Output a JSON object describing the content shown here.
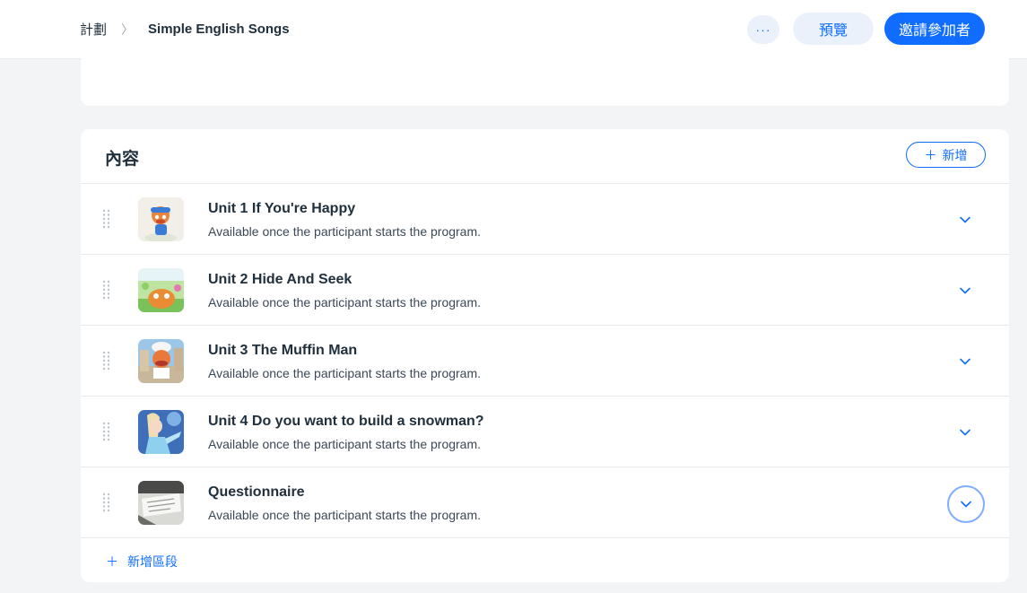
{
  "breadcrumb": {
    "parent": "計劃",
    "separator": "〉",
    "current": "Simple English Songs"
  },
  "header": {
    "more_label": "···",
    "preview_label": "預覽",
    "invite_label": "邀請參加者"
  },
  "content": {
    "title": "內容",
    "add_label": "新增",
    "add_icon": "＋",
    "items": [
      {
        "title": "Unit 1 If You're Happy",
        "subtitle": "Available once the participant starts the program.",
        "thumb": "cartoon-happy"
      },
      {
        "title": "Unit 2 Hide And Seek",
        "subtitle": "Available once the participant starts the program.",
        "thumb": "cartoon-hide"
      },
      {
        "title": "Unit 3 The Muffin Man",
        "subtitle": "Available once the participant starts the program.",
        "thumb": "cartoon-muffin"
      },
      {
        "title": "Unit 4 Do you want to build a snowman?",
        "subtitle": "Available once the participant starts the program.",
        "thumb": "cartoon-snowman"
      },
      {
        "title": "Questionnaire",
        "subtitle": "Available once the participant starts the program.",
        "thumb": "photo-questionnaire"
      }
    ],
    "add_section_icon": "＋",
    "add_section_label": "新增區段"
  },
  "colors": {
    "accent": "#116dff",
    "accent_soft": "#eaf1fb",
    "text": "#20303c",
    "background": "#f3f4f6"
  }
}
